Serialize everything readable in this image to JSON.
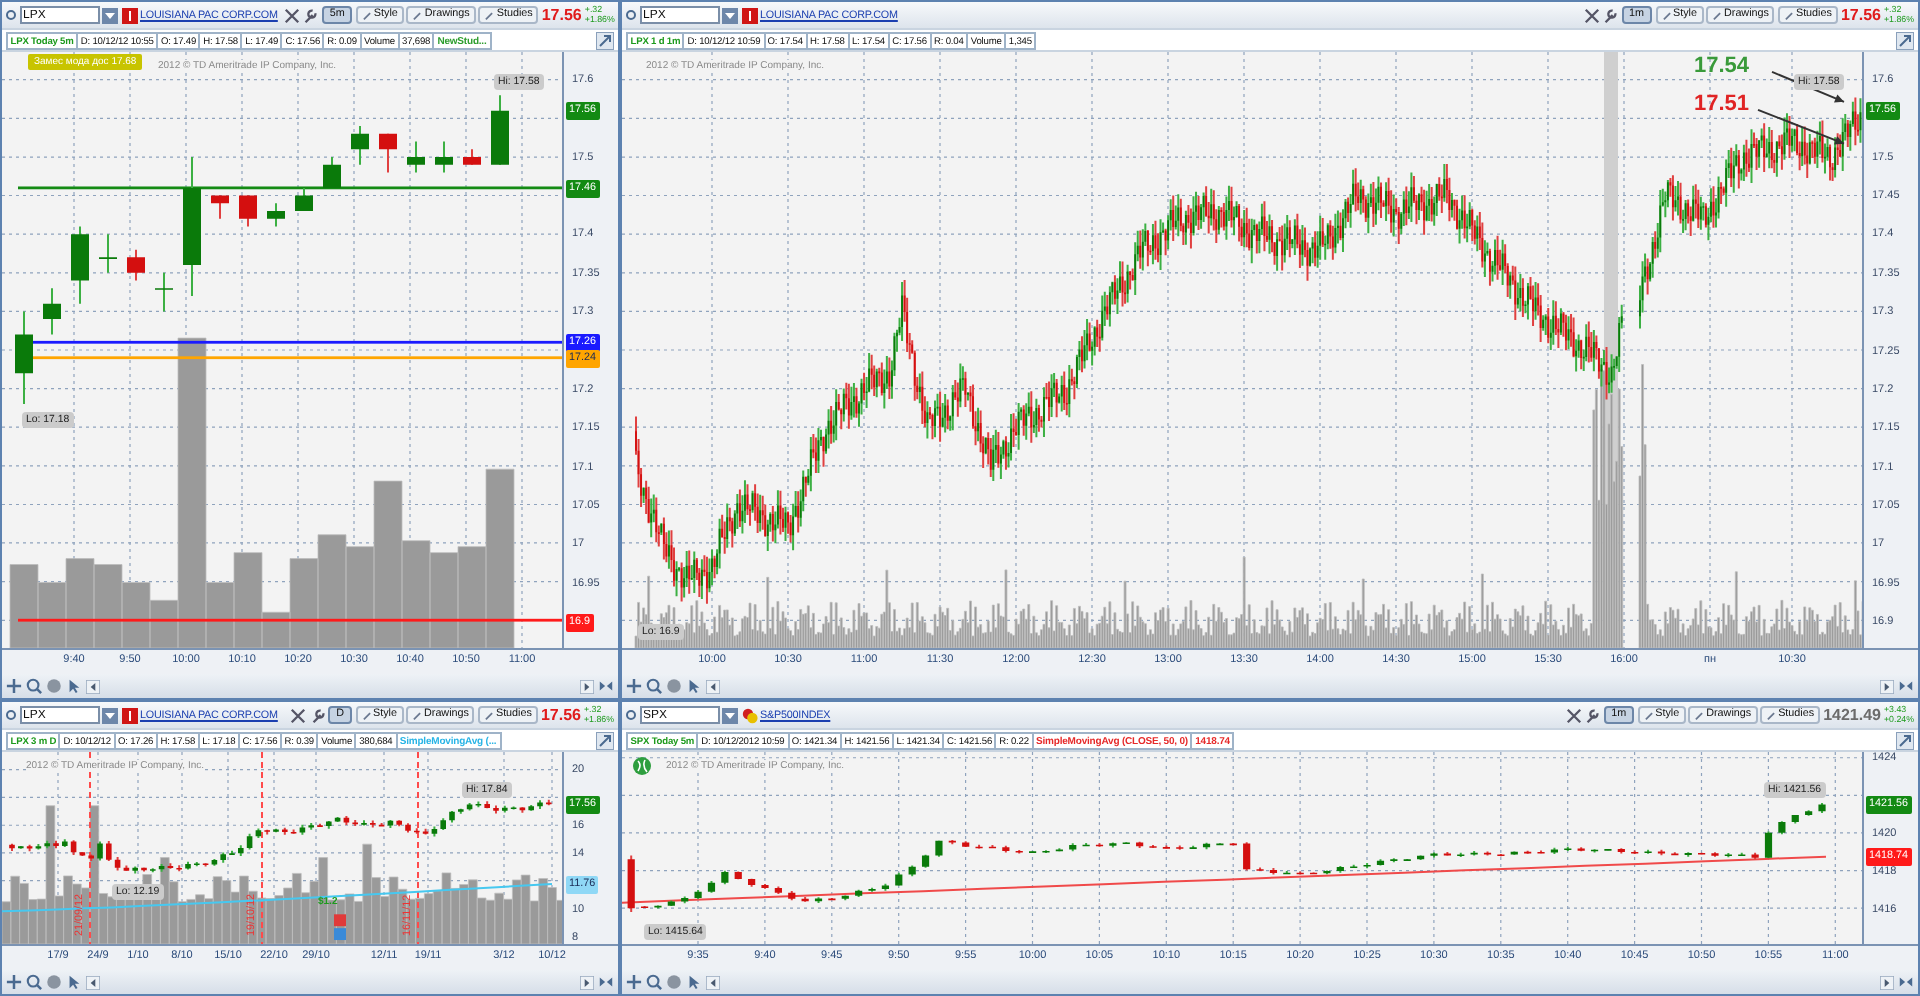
{
  "panels": [
    {
      "symbol": "LPX",
      "company": "LOUISIANA PAC CORP.COM",
      "period": "5m",
      "buttons": [
        "Style",
        "Drawings",
        "Studies"
      ],
      "price": "17.56",
      "falling": true,
      "change": "+.32",
      "change_pct": "+1.86%",
      "info": [
        {
          "text": "LPX Today 5m",
          "kind": "title"
        },
        {
          "text": "D: 10/12/12 10:55",
          "kind": "field"
        },
        {
          "text": "O: 17.49",
          "kind": "field"
        },
        {
          "text": "H: 17.58",
          "kind": "field"
        },
        {
          "text": "L: 17.49",
          "kind": "field"
        },
        {
          "text": "C: 17.56",
          "kind": "field"
        },
        {
          "text": "R: 0.09",
          "kind": "field"
        },
        {
          "text": "Volume",
          "kind": "field"
        },
        {
          "text": "37,698",
          "kind": "field"
        },
        {
          "text": "NewStud...",
          "kind": "study",
          "color": "#2e9e2e"
        }
      ],
      "copyright": "2012 © TD Ameritrade IP Company, Inc.",
      "y_ticks": [
        "17.6",
        "17.5",
        "17.4",
        "17.35",
        "17.3",
        "17.2",
        "17.15",
        "17.1",
        "17.05",
        "17",
        "16.95"
      ],
      "x_ticks": [
        "9:40",
        "9:50",
        "10:00",
        "10:10",
        "10:20",
        "10:30",
        "10:40",
        "10:50",
        "11:00"
      ],
      "badges": [
        {
          "text": "17.56",
          "color": "#138a13",
          "line": false
        },
        {
          "text": "17.46",
          "color": "#138a13",
          "line": true
        },
        {
          "text": "17.26",
          "color": "#1a1aff",
          "line": true
        },
        {
          "text": "17.24",
          "color": "#ffa500",
          "line": true
        },
        {
          "text": "16.9",
          "color": "#ff1a1a",
          "line": true
        }
      ],
      "annotations": [
        {
          "text": "Замес мода дос 17.68",
          "kind": "tag"
        },
        {
          "text": "Hi: 17.58",
          "kind": "high"
        },
        {
          "text": "Lo: 17.18",
          "kind": "low"
        }
      ]
    },
    {
      "symbol": "LPX",
      "company": "LOUISIANA PAC CORP.COM",
      "period": "1m",
      "buttons": [
        "Style",
        "Drawings",
        "Studies"
      ],
      "price": "17.56",
      "falling": true,
      "change": "+.32",
      "change_pct": "+1.86%",
      "info": [
        {
          "text": "LPX 1 d 1m",
          "kind": "title"
        },
        {
          "text": "D: 10/12/12 10:59",
          "kind": "field"
        },
        {
          "text": "O: 17.54",
          "kind": "field"
        },
        {
          "text": "H: 17.58",
          "kind": "field"
        },
        {
          "text": "L: 17.54",
          "kind": "field"
        },
        {
          "text": "C: 17.56",
          "kind": "field"
        },
        {
          "text": "R: 0.04",
          "kind": "field"
        },
        {
          "text": "Volume",
          "kind": "field"
        },
        {
          "text": "1,345",
          "kind": "field"
        }
      ],
      "copyright": "2012 © TD Ameritrade IP Company, Inc.",
      "y_ticks": [
        "17.6",
        "17.5",
        "17.45",
        "17.4",
        "17.35",
        "17.3",
        "17.25",
        "17.2",
        "17.15",
        "17.1",
        "17.05",
        "17",
        "16.95",
        "16.9"
      ],
      "x_ticks": [
        "10:00",
        "10:30",
        "11:00",
        "11:30",
        "12:00",
        "12:30",
        "13:00",
        "13:30",
        "14:00",
        "14:30",
        "15:00",
        "15:30",
        "16:00",
        "пн",
        "10:30"
      ],
      "badges": [
        {
          "text": "17.56",
          "color": "#138a13",
          "line": false
        }
      ],
      "annotations": [
        {
          "text": "17.54",
          "kind": "callout",
          "color": "#3a9a3a"
        },
        {
          "text": "17.51",
          "kind": "callout",
          "color": "#e02424"
        },
        {
          "text": "Hi: 17.58",
          "kind": "high"
        },
        {
          "text": "Lo: 16.9",
          "kind": "low"
        }
      ]
    },
    {
      "symbol": "LPX",
      "company": "LOUISIANA PAC CORP.COM",
      "period": "D",
      "buttons": [
        "Style",
        "Drawings",
        "Studies"
      ],
      "price": "17.56",
      "falling": true,
      "change": "+.32",
      "change_pct": "+1.86%",
      "info": [
        {
          "text": "LPX 3 m D",
          "kind": "title"
        },
        {
          "text": "D: 10/12/12",
          "kind": "field"
        },
        {
          "text": "O: 17.26",
          "kind": "field"
        },
        {
          "text": "H: 17.58",
          "kind": "field"
        },
        {
          "text": "L: 17.18",
          "kind": "field"
        },
        {
          "text": "C: 17.56",
          "kind": "field"
        },
        {
          "text": "R: 0.39",
          "kind": "field"
        },
        {
          "text": "Volume",
          "kind": "field"
        },
        {
          "text": "380,684",
          "kind": "field"
        },
        {
          "text": "SimpleMovingAvg (...",
          "kind": "study",
          "color": "#28b4e6"
        }
      ],
      "copyright": "2012 © TD Ameritrade IP Company, Inc.",
      "y_ticks": [
        "20",
        "16",
        "14",
        "10",
        "8"
      ],
      "x_ticks": [
        "17/9",
        "24/9",
        "1/10",
        "8/10",
        "15/10",
        "22/10",
        "29/10",
        "12/11",
        "19/11",
        "3/12",
        "10/12"
      ],
      "badges": [
        {
          "text": "17.56",
          "color": "#138a13",
          "line": false
        },
        {
          "text": "11.76",
          "color": "#8fd8f6",
          "line": false
        }
      ],
      "annotations": [
        {
          "text": "Hi: 17.84",
          "kind": "high"
        },
        {
          "text": "Lo: 12.19",
          "kind": "low"
        },
        {
          "text": "$1.2",
          "kind": "dividend"
        }
      ],
      "markers": [
        "21/09/12",
        "19/10/12",
        "16/11/12"
      ]
    },
    {
      "symbol": "SPX",
      "company": "S&P500INDEX",
      "period": "1m",
      "buttons": [
        "Style",
        "Drawings",
        "Studies"
      ],
      "price": "1421.49",
      "falling": false,
      "change": "+3.43",
      "change_pct": "+0.24%",
      "info": [
        {
          "text": "SPX Today 5m",
          "kind": "title"
        },
        {
          "text": "D: 10/12/2012 10:59",
          "kind": "field"
        },
        {
          "text": "O: 1421.34",
          "kind": "field"
        },
        {
          "text": "H: 1421.56",
          "kind": "field"
        },
        {
          "text": "L: 1421.34",
          "kind": "field"
        },
        {
          "text": "C: 1421.56",
          "kind": "field"
        },
        {
          "text": "R: 0.22",
          "kind": "field"
        },
        {
          "text": "SimpleMovingAvg (CLOSE, 50, 0)",
          "kind": "study",
          "color": "#e62a2a"
        },
        {
          "text": "1418.74",
          "kind": "study",
          "color": "#e62a2a"
        }
      ],
      "copyright": "2012 © TD Ameritrade IP Company, Inc.",
      "y_ticks": [
        "1424",
        "1420",
        "1418",
        "1416"
      ],
      "x_ticks": [
        "9:35",
        "9:40",
        "9:45",
        "9:50",
        "9:55",
        "10:00",
        "10:05",
        "10:10",
        "10:15",
        "10:20",
        "10:25",
        "10:30",
        "10:35",
        "10:40",
        "10:45",
        "10:50",
        "10:55",
        "11:00"
      ],
      "badges": [
        {
          "text": "1421.56",
          "color": "#138a13",
          "line": false
        },
        {
          "text": "1418.74",
          "color": "#ff1a1a",
          "line": false
        }
      ],
      "annotations": [
        {
          "text": "Hi: 1421.56",
          "kind": "high"
        },
        {
          "text": "Lo: 1415.64",
          "kind": "low"
        }
      ]
    }
  ]
}
